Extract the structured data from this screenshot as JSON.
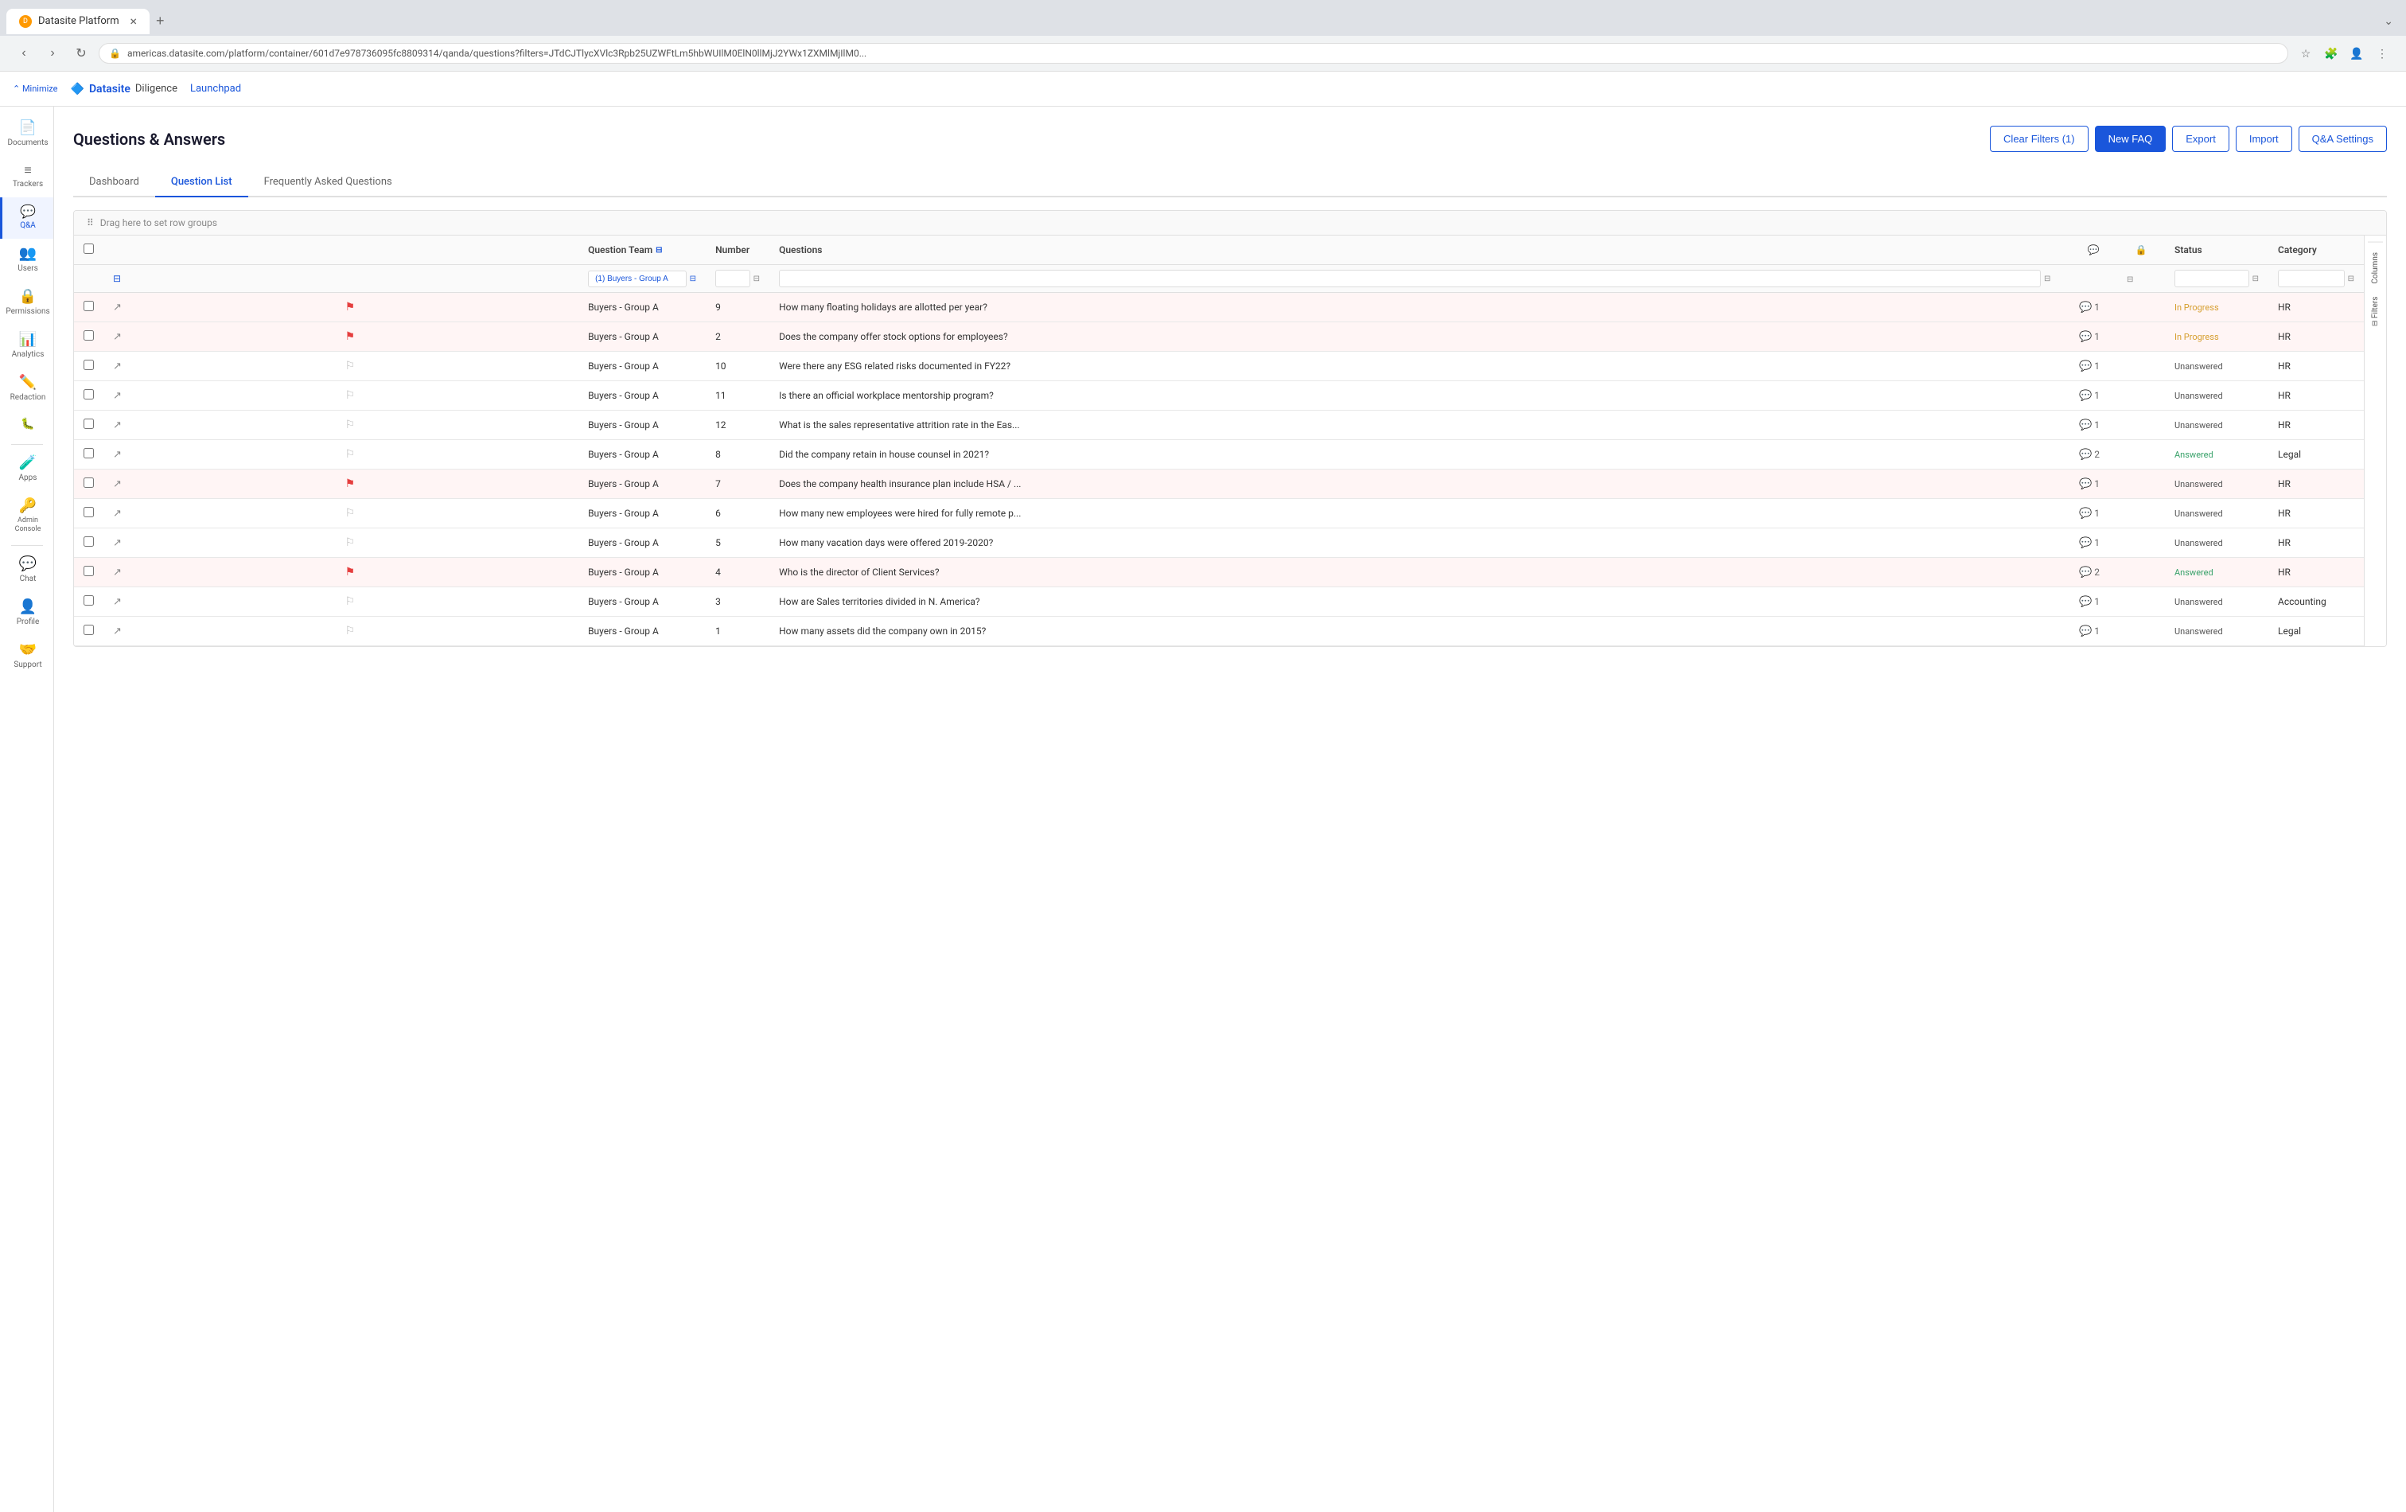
{
  "browser": {
    "tab_title": "Datasite Platform",
    "favicon_text": "D",
    "url": "americas.datasite.com/platform/container/601d7e978736095fc8809314/qanda/questions?filters=JTdCJTlycXVlc3Rpb25UZWFtLm5hbWUIlM0ElN0llMjJ2YWx1ZXMlMjIlM0...",
    "new_tab_label": "+",
    "minimize_text": "⌃ Minimize"
  },
  "app": {
    "logo_text": "Datasite",
    "product_text": "Diligence",
    "launchpad_text": "Launchpad"
  },
  "sidebar": {
    "items": [
      {
        "id": "documents",
        "label": "Documents",
        "icon": "📄"
      },
      {
        "id": "trackers",
        "label": "Trackers",
        "icon": "≡"
      },
      {
        "id": "qanda",
        "label": "Q&A",
        "icon": "💬",
        "active": true
      },
      {
        "id": "users",
        "label": "Users",
        "icon": "👥"
      },
      {
        "id": "permissions",
        "label": "Permissions",
        "icon": "🔒"
      },
      {
        "id": "analytics",
        "label": "Analytics",
        "icon": "📊"
      },
      {
        "id": "redaction",
        "label": "Redaction",
        "icon": "✏️"
      },
      {
        "id": "more",
        "label": "",
        "icon": "🐛"
      },
      {
        "id": "apps",
        "label": "Apps",
        "icon": "🧪"
      },
      {
        "id": "admin-console",
        "label": "Admin Console",
        "icon": "🔑"
      },
      {
        "id": "chat",
        "label": "Chat",
        "icon": "💬"
      },
      {
        "id": "profile",
        "label": "Profile",
        "icon": "👤"
      },
      {
        "id": "support",
        "label": "Support",
        "icon": "🤝"
      }
    ]
  },
  "page": {
    "title": "Questions & Answers",
    "buttons": {
      "clear_filters": "Clear Filters (1)",
      "new_faq": "New FAQ",
      "export": "Export",
      "import": "Import",
      "qa_settings": "Q&A Settings"
    },
    "tabs": [
      {
        "id": "dashboard",
        "label": "Dashboard",
        "active": false
      },
      {
        "id": "question-list",
        "label": "Question List",
        "active": true
      },
      {
        "id": "faq",
        "label": "Frequently Asked Questions",
        "active": false
      }
    ]
  },
  "table": {
    "drag_text": "Drag here to set row groups",
    "columns": {
      "question_team": "Question Team",
      "number": "Number",
      "questions": "Questions",
      "chat": "💬",
      "lock": "🔒",
      "status": "Status",
      "category": "Category"
    },
    "filter_values": {
      "team_filter": "(1) Buyers - Group A",
      "number_filter": "",
      "questions_filter": "",
      "status_filter": "",
      "category_filter": ""
    },
    "rows": [
      {
        "id": 1,
        "flagged": true,
        "team": "Buyers - Group A",
        "number": "9",
        "question": "How many floating holidays are allotted per year?",
        "chat": 1,
        "lock": false,
        "status": "In Progress",
        "category": "HR",
        "highlighted": true
      },
      {
        "id": 2,
        "flagged": true,
        "team": "Buyers - Group A",
        "number": "2",
        "question": "Does the company offer stock options for employees?",
        "chat": 1,
        "lock": false,
        "status": "In Progress",
        "category": "HR",
        "highlighted": true
      },
      {
        "id": 3,
        "flagged": false,
        "team": "Buyers - Group A",
        "number": "10",
        "question": "Were there any ESG related risks documented in FY22?",
        "chat": 1,
        "lock": false,
        "status": "Unanswered",
        "category": "HR",
        "highlighted": false
      },
      {
        "id": 4,
        "flagged": false,
        "team": "Buyers - Group A",
        "number": "11",
        "question": "Is there an official workplace mentorship program?",
        "chat": 1,
        "lock": false,
        "status": "Unanswered",
        "category": "HR",
        "highlighted": false
      },
      {
        "id": 5,
        "flagged": false,
        "team": "Buyers - Group A",
        "number": "12",
        "question": "What is the sales representative attrition rate in the Eas...",
        "chat": 1,
        "lock": false,
        "status": "Unanswered",
        "category": "HR",
        "highlighted": false
      },
      {
        "id": 6,
        "flagged": false,
        "team": "Buyers - Group A",
        "number": "8",
        "question": "Did the company retain in house counsel in 2021?",
        "chat": 2,
        "lock": false,
        "status": "Answered",
        "category": "Legal",
        "highlighted": false
      },
      {
        "id": 7,
        "flagged": true,
        "team": "Buyers - Group A",
        "number": "7",
        "question": "Does the company health insurance plan include HSA / ...",
        "chat": 1,
        "lock": false,
        "status": "Unanswered",
        "category": "HR",
        "highlighted": true
      },
      {
        "id": 8,
        "flagged": false,
        "team": "Buyers - Group A",
        "number": "6",
        "question": "How many new employees were hired for fully remote p...",
        "chat": 1,
        "lock": false,
        "status": "Unanswered",
        "category": "HR",
        "highlighted": false
      },
      {
        "id": 9,
        "flagged": false,
        "team": "Buyers - Group A",
        "number": "5",
        "question": "How many vacation days were offered 2019-2020?",
        "chat": 1,
        "lock": false,
        "status": "Unanswered",
        "category": "HR",
        "highlighted": false
      },
      {
        "id": 10,
        "flagged": true,
        "team": "Buyers - Group A",
        "number": "4",
        "question": "Who is the director of Client Services?",
        "chat": 2,
        "lock": false,
        "status": "Answered",
        "category": "HR",
        "highlighted": true
      },
      {
        "id": 11,
        "flagged": false,
        "team": "Buyers - Group A",
        "number": "3",
        "question": "How are Sales territories divided in N. America?",
        "chat": 1,
        "lock": false,
        "status": "Unanswered",
        "category": "Accounting",
        "highlighted": false
      },
      {
        "id": 12,
        "flagged": false,
        "team": "Buyers - Group A",
        "number": "1",
        "question": "How many assets did the company own in 2015?",
        "chat": 1,
        "lock": false,
        "status": "Unanswered",
        "category": "Legal",
        "highlighted": false
      }
    ]
  },
  "right_panel": {
    "columns_label": "Columns",
    "filters_label": "Filters"
  }
}
